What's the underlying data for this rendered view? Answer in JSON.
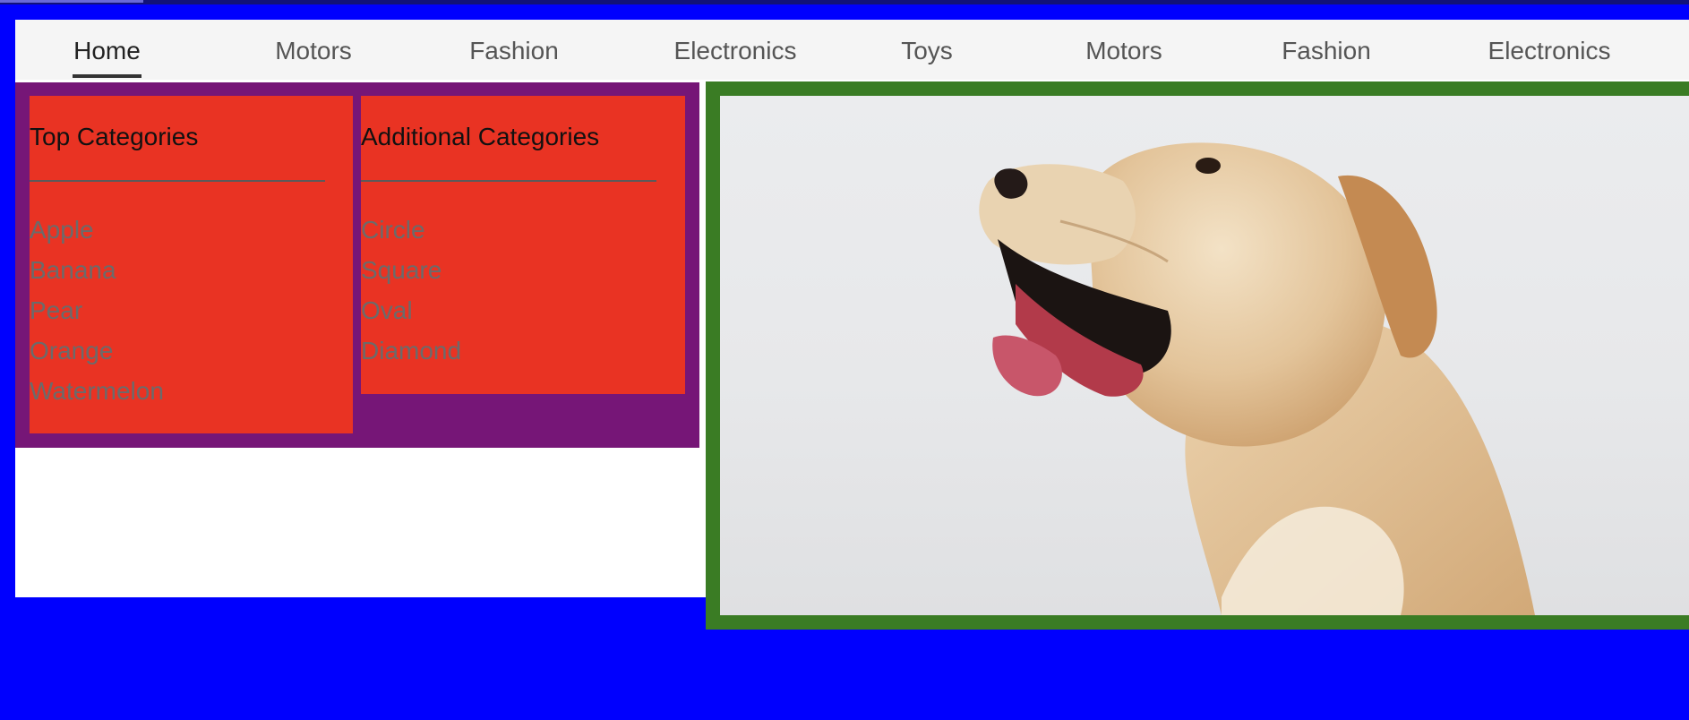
{
  "nav": {
    "items": [
      {
        "label": "Home",
        "active": true
      },
      {
        "label": "Motors"
      },
      {
        "label": "Fashion"
      },
      {
        "label": "Electronics"
      },
      {
        "label": "Toys"
      },
      {
        "label": "Motors"
      },
      {
        "label": "Fashion"
      },
      {
        "label": "Electronics"
      }
    ]
  },
  "menu": {
    "columns": [
      {
        "heading": "Top Categories",
        "items": [
          "Apple",
          "Banana",
          "Pear",
          "Orange",
          "Watermelon"
        ]
      },
      {
        "heading": "Additional Categories",
        "items": [
          "Circle",
          "Square",
          "Oval",
          "Diamond"
        ]
      }
    ]
  },
  "photo": {
    "subject": "golden retriever yawning"
  },
  "colors": {
    "page_background": "#0000fe",
    "menu_panel": "#761677",
    "menu_column": "#e93323",
    "photo_border": "#3a7c24",
    "nav_background": "#f5f5f5"
  }
}
